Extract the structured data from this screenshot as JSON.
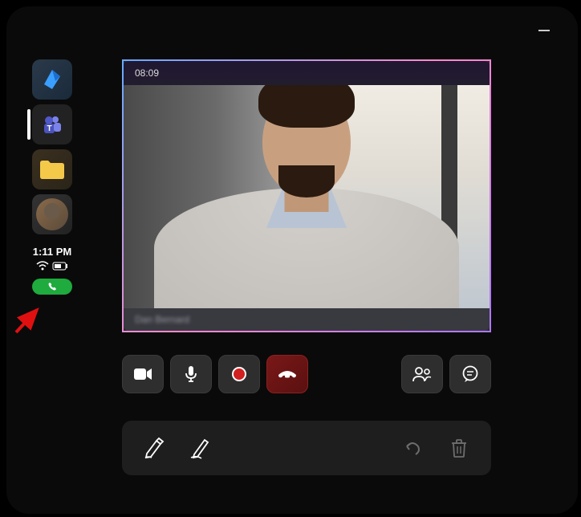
{
  "window": {
    "minimize_label": "Minimize"
  },
  "sidebar": {
    "apps": [
      {
        "name": "dynamics",
        "label": "Dynamics"
      },
      {
        "name": "teams",
        "label": "Teams",
        "active": true
      },
      {
        "name": "files",
        "label": "Files"
      },
      {
        "name": "profile",
        "label": "Profile"
      }
    ],
    "time": "1:11 PM",
    "wifi_status": "connected",
    "battery_status": "charging",
    "call_pill_label": "Active call"
  },
  "call": {
    "timer": "08:09",
    "participant_name": "Dan Bernard"
  },
  "controls": {
    "camera_label": "Camera",
    "mic_label": "Microphone",
    "record_label": "Record",
    "hangup_label": "End call",
    "people_label": "Participants",
    "chat_label": "Chat"
  },
  "toolbar": {
    "highlighter_label": "Highlighter",
    "pen_label": "Pen",
    "undo_label": "Undo",
    "delete_label": "Delete"
  },
  "annotation": {
    "arrow_color": "#e01010"
  }
}
